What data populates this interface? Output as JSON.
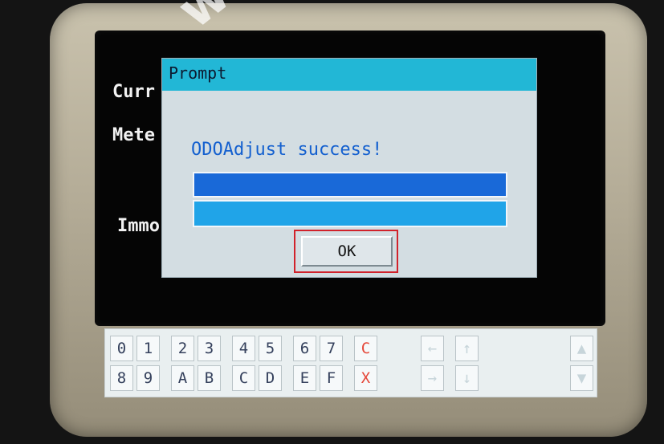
{
  "background_labels": [
    "Curr",
    "Mete",
    "Immo"
  ],
  "watermark": "www",
  "dialog": {
    "title": "Prompt",
    "message": "ODOAdjust success!",
    "ok_label": "OK"
  },
  "keypad": {
    "row1": [
      "0",
      "1",
      "2",
      "3",
      "4",
      "5",
      "6",
      "7",
      "C",
      "←",
      "↑",
      "▲"
    ],
    "row2": [
      "8",
      "9",
      "A",
      "B",
      "C",
      "D",
      "E",
      "F",
      "X",
      "→",
      "↓",
      "▼"
    ]
  },
  "colors": {
    "title_bar": "#22b7d6",
    "dialog_bg": "#d3dde2",
    "message_text": "#1460cf",
    "highlight": "#d1222b",
    "red_key": "#e5483a"
  }
}
